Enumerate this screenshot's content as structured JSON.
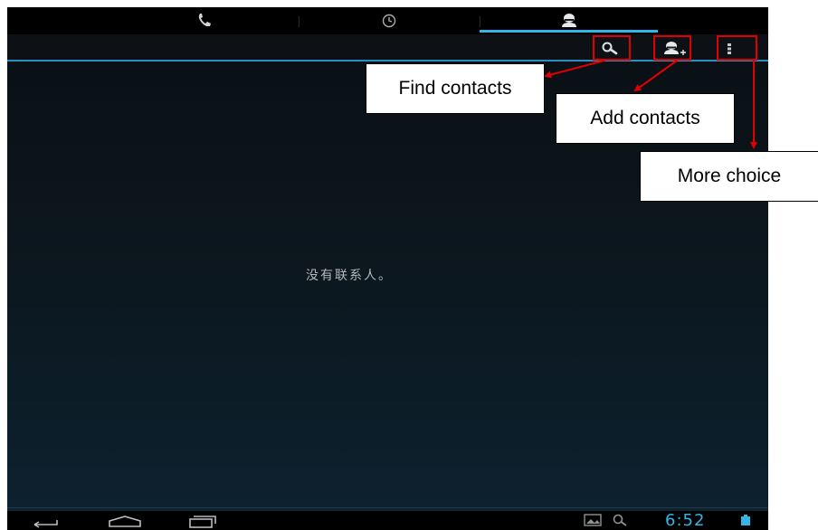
{
  "tabs": [
    {
      "name": "phone",
      "icon": "phone-icon"
    },
    {
      "name": "recent",
      "icon": "clock-icon"
    },
    {
      "name": "contacts",
      "icon": "person-icon",
      "selected": true
    }
  ],
  "action_bar": {
    "search_icon": "search-icon",
    "add_contact_icon": "add-person-icon",
    "overflow_icon": "overflow-menu-icon"
  },
  "empty_message": "没有联系人。",
  "status_bar": {
    "time": "6:52",
    "icons": [
      "gallery-icon",
      "search-icon",
      "battery-icon"
    ]
  },
  "nav_icons": [
    "back-icon",
    "home-icon",
    "recent-apps-icon"
  ],
  "annotations": {
    "find": "Find contacts",
    "add": "Add contacts",
    "more": "More choice"
  },
  "colors": {
    "accent": "#33b5e5",
    "annotation": "#e00000",
    "background": "#0c1820"
  }
}
